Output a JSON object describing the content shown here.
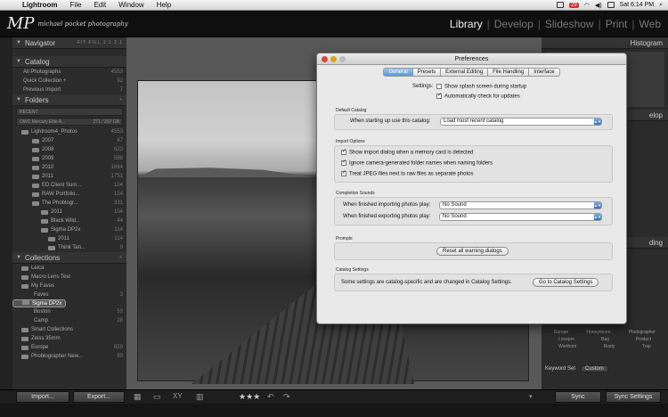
{
  "menubar": {
    "app": "Lightroom",
    "items": [
      "File",
      "Edit",
      "Window",
      "Help"
    ],
    "badge": "29",
    "clock": "Sat 6:14 PM"
  },
  "identity": {
    "monogram": "MP",
    "tagline": "michael pocket photography"
  },
  "modules": [
    "Library",
    "Develop",
    "Slideshow",
    "Print",
    "Web"
  ],
  "navigator": {
    "title": "Navigator",
    "zoom": "FIT  FILL  1:1  3:1"
  },
  "catalog": {
    "title": "Catalog",
    "items": [
      {
        "label": "All Photographs",
        "count": "4553"
      },
      {
        "label": "Quick Collection +",
        "count": "92"
      },
      {
        "label": "Previous Import",
        "count": "7"
      }
    ]
  },
  "folders": {
    "title": "Folders",
    "filter": "RECENT",
    "volume": "OWC Mercury Elite A...",
    "volume_info": "271 / 297 GB",
    "items": [
      {
        "label": "Lightroom4_Photos",
        "count": "4553"
      },
      {
        "label": "2007",
        "count": "47"
      },
      {
        "label": "2008",
        "count": "623"
      },
      {
        "label": "2009",
        "count": "588"
      },
      {
        "label": "2010",
        "count": "1664"
      },
      {
        "label": "2011",
        "count": "1751"
      },
      {
        "label": "ED Client Sum...",
        "count": "104"
      },
      {
        "label": "RAW Portfolio...",
        "count": "124"
      },
      {
        "label": "The Phoblogr...",
        "count": "331"
      },
      {
        "label": "2011",
        "count": "104"
      },
      {
        "label": "Black Wild...",
        "count": "44"
      },
      {
        "label": "Sigma DP2x",
        "count": "114"
      },
      {
        "label": "2011",
        "count": "114"
      },
      {
        "label": "Think Tan...",
        "count": "9"
      }
    ]
  },
  "collections": {
    "title": "Collections",
    "items": [
      {
        "label": "Leica",
        "count": ""
      },
      {
        "label": "Macro Lens Test",
        "count": ""
      },
      {
        "label": "My Faves",
        "count": ""
      },
      {
        "label": "Faves",
        "count": "3"
      },
      {
        "label": "Sigma DP2x",
        "count": ""
      },
      {
        "label": "Boston",
        "count": "53"
      },
      {
        "label": "Camp",
        "count": "28"
      },
      {
        "label": "Smart Collections",
        "count": ""
      },
      {
        "label": "Zeiss 35mm",
        "count": ""
      },
      {
        "label": "Europe",
        "count": "859"
      },
      {
        "label": "Phoblographer New...",
        "count": "93"
      }
    ]
  },
  "right": {
    "histogram": "Histogram",
    "develop_frag": "elop",
    "keywording_frag": "ding",
    "keyword_set_label": "Keyword Set",
    "keyword_set_value": "Custom",
    "keywords": [
      "Europe",
      "Honeymoon",
      "Photographer",
      "Lovepro",
      "Bag",
      "Product",
      "Wartham",
      "Rusty",
      "Trap"
    ],
    "sync_label": "Sync",
    "sync_settings_label": "Sync Settings"
  },
  "bottom": {
    "import": "Import...",
    "export": "Export...",
    "stars": "★★★"
  },
  "prefs": {
    "title": "Preferences",
    "tabs": [
      "General",
      "Presets",
      "External Editing",
      "File Handling",
      "Interface"
    ],
    "settings_label": "Settings:",
    "show_splash": "Show splash screen during startup",
    "auto_check": "Automatically check for updates",
    "default_catalog": {
      "section": "Default Catalog",
      "label": "When starting up use this catalog:",
      "value": "Load most recent catalog"
    },
    "import_options": {
      "section": "Import Options",
      "items": [
        "Show import dialog when a memory card is detected",
        "Ignore camera-generated folder names when naming folders",
        "Treat JPEG files next to raw files as separate photos"
      ]
    },
    "completion_sounds": {
      "section": "Completion Sounds",
      "import_label": "When finished importing photos play:",
      "import_value": "No Sound",
      "export_label": "When finished exporting photos play:",
      "export_value": "No Sound"
    },
    "prompts": {
      "section": "Prompts",
      "reset_button": "Reset all warning dialogs"
    },
    "catalog_settings": {
      "section": "Catalog Settings",
      "text": "Some settings are catalog-specific and are changed in Catalog Settings.",
      "button": "Go to Catalog Settings"
    }
  }
}
